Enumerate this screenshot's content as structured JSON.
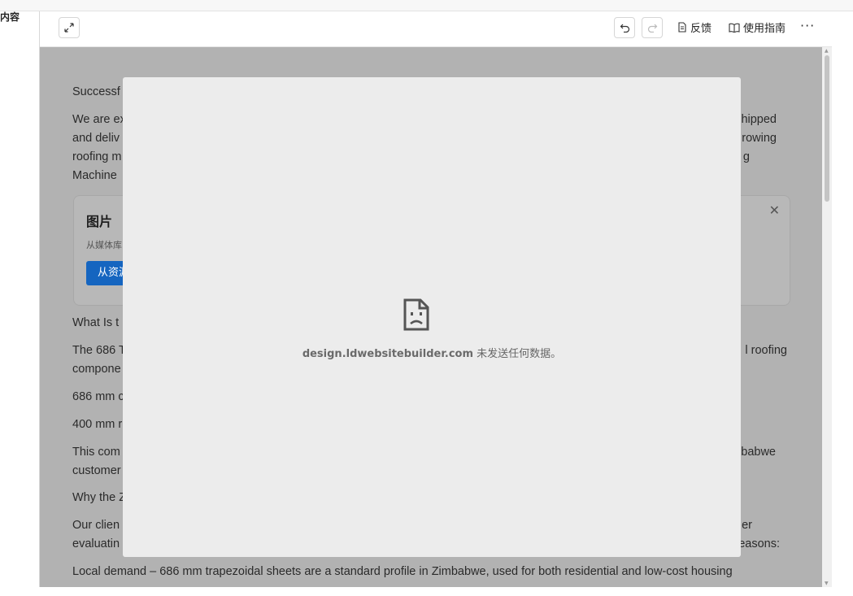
{
  "sidebar": {
    "label": "内容"
  },
  "toolbar": {
    "feedback_label": "反馈",
    "guide_label": "使用指南",
    "more_label": "···"
  },
  "content": {
    "heading1": "Successf",
    "para1": [
      "We are ex",
      "and deliv",
      "roofing m",
      "Machine "
    ],
    "para1_right": [
      "hipped",
      "rowing",
      "g"
    ],
    "image_card": {
      "title": "图片",
      "subtitle": "从媒体库",
      "button_label": "从资源"
    },
    "heading2": "What Is t",
    "para2": [
      "The 686 T",
      "compone"
    ],
    "para2_right": [
      "l roofing"
    ],
    "spec1": "686 mm c",
    "spec2": "400 mm r",
    "para3": [
      "This com",
      "customer"
    ],
    "para3_right": [
      "babwe"
    ],
    "heading3": "Why the Z",
    "para4": [
      "Our clien",
      "evaluatin"
    ],
    "para4_right": [
      "er",
      "easons:"
    ],
    "para5": "Local demand – 686 mm trapezoidal sheets are a standard profile in Zimbabwe, used for both residential and low-cost housing"
  },
  "error": {
    "host": "design.ldwebsitebuilder.com",
    "message": " 未发送任何数据。"
  }
}
